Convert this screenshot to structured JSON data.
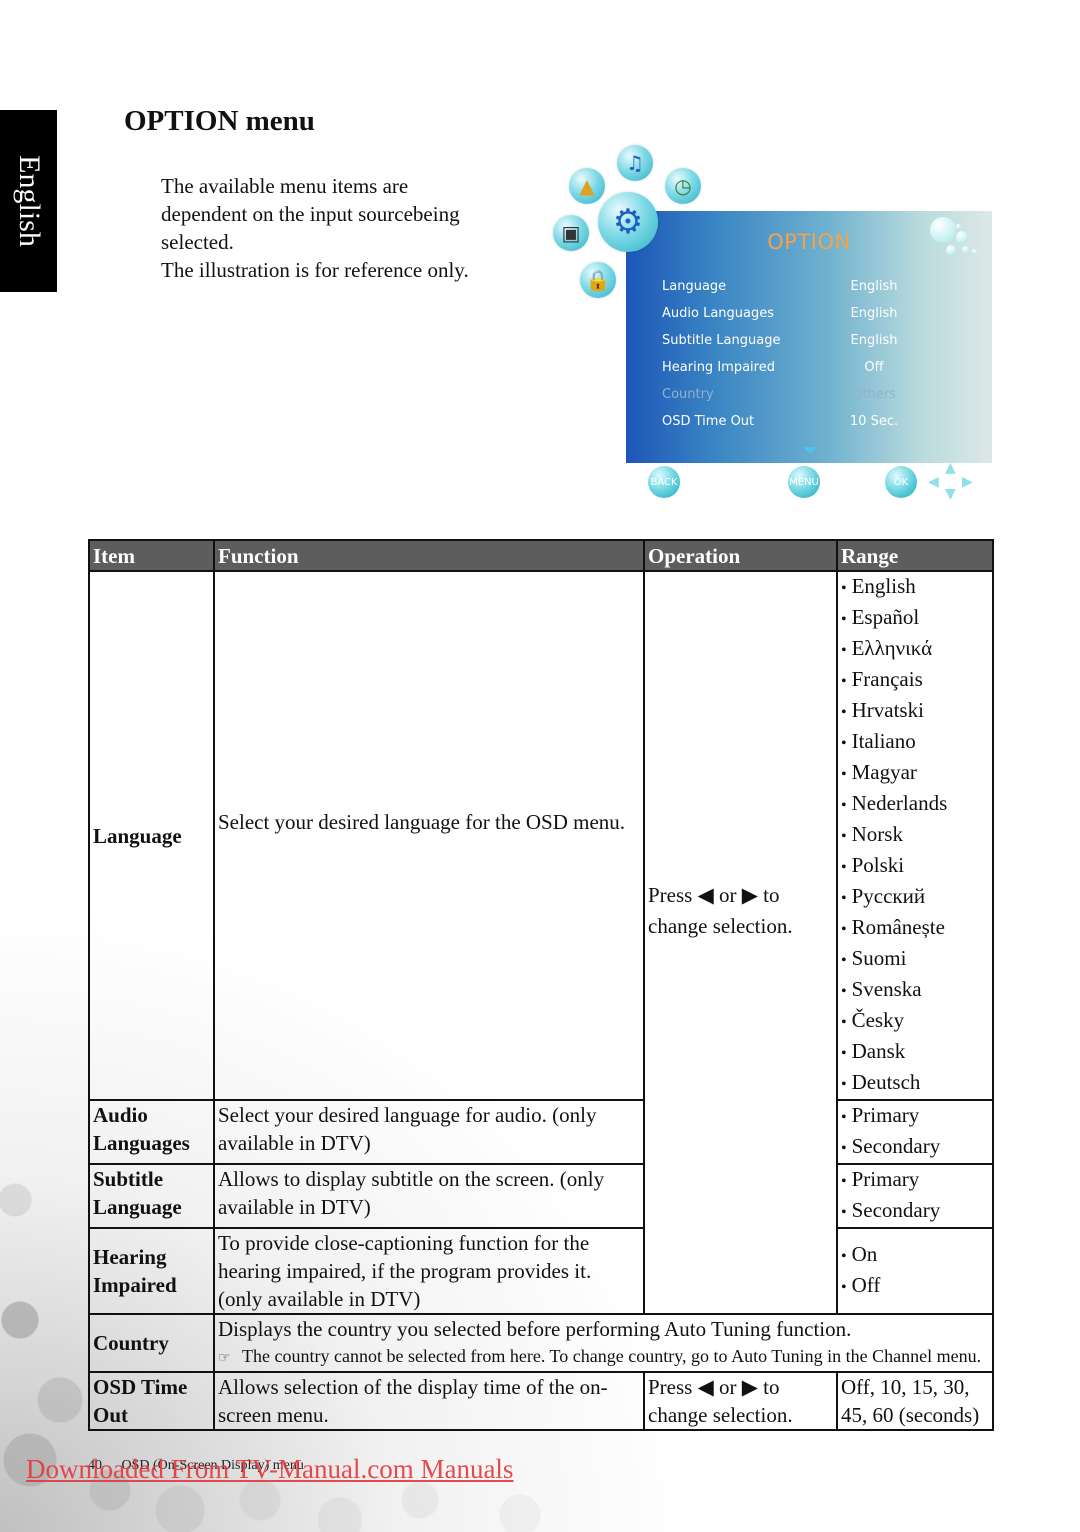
{
  "side_tab": "English",
  "page_title": "OPTION menu",
  "intro": [
    "The available menu items are",
    "dependent on the input sourcebeing",
    "selected.",
    "The illustration is for reference only."
  ],
  "osd": {
    "title": "OPTION",
    "icons": [
      "music-icon",
      "picture-icon",
      "clock-globe-icon",
      "tv-icon",
      "gear-icon",
      "lock-icon"
    ],
    "rows": [
      {
        "label": "Language",
        "value": "English",
        "disabled": false
      },
      {
        "label": "Audio Languages",
        "value": "English",
        "disabled": false
      },
      {
        "label": "Subtitle Language",
        "value": "English",
        "disabled": false
      },
      {
        "label": "Hearing Impaired",
        "value": "Off",
        "disabled": false
      },
      {
        "label": "Country",
        "value": "Others",
        "disabled": true
      },
      {
        "label": "OSD Time Out",
        "value": "10 Sec.",
        "disabled": false
      }
    ],
    "buttons": {
      "back": "BACK",
      "menu": "MENU",
      "ok": "OK"
    },
    "colors": {
      "title": "#f5a24a",
      "panel_left": "#1d56b8",
      "panel_right": "#dde8e6"
    }
  },
  "table": {
    "headers": [
      "Item",
      "Function",
      "Operation",
      "Range"
    ],
    "header_bg": "#5d5d5d",
    "operation_text": "Press ◀ or ▶ to change selection.",
    "rows": [
      {
        "item": "Language",
        "function": "Select your desired language for the OSD menu.",
        "range": [
          "English",
          "Español",
          "Ελληνικά",
          "Français",
          "Hrvatski",
          "Italiano",
          "Magyar",
          "Nederlands",
          "Norsk",
          "Polski",
          "Русский",
          "Românește",
          "Suomi",
          "Svenska",
          "Česky",
          "Dansk",
          "Deutsch"
        ]
      },
      {
        "item": "Audio Languages",
        "function": "Select your desired language for audio. (only available in DTV)",
        "range": [
          "Primary",
          "Secondary"
        ]
      },
      {
        "item": "Subtitle Language",
        "function": "Allows to display subtitle on the screen. (only available in DTV)",
        "range": [
          "Primary",
          "Secondary"
        ]
      },
      {
        "item": "Hearing Impaired",
        "function": "To provide close-captioning function for the hearing impaired, if the program provides it. (only available in DTV)",
        "range": [
          "On",
          "Off"
        ]
      },
      {
        "item": "Country",
        "function": "Displays the country you selected before performing Auto Tuning function.",
        "note": "The country cannot be selected from here. To change country, go to Auto Tuning in the Channel menu."
      },
      {
        "item": "OSD Time Out",
        "function": "Allows selection of the display time of the on-screen menu.",
        "operation": "Press ◀ or ▶ to change selection.",
        "range_text": "Off, 10, 15, 30, 45, 60 (seconds)"
      }
    ]
  },
  "footer": {
    "page_number": "40",
    "section": "OSD (On-Screen Display) menu"
  },
  "watermark": {
    "text": "Downloaded From TV-Manual.com Manuals",
    "color": "#e4383c"
  }
}
